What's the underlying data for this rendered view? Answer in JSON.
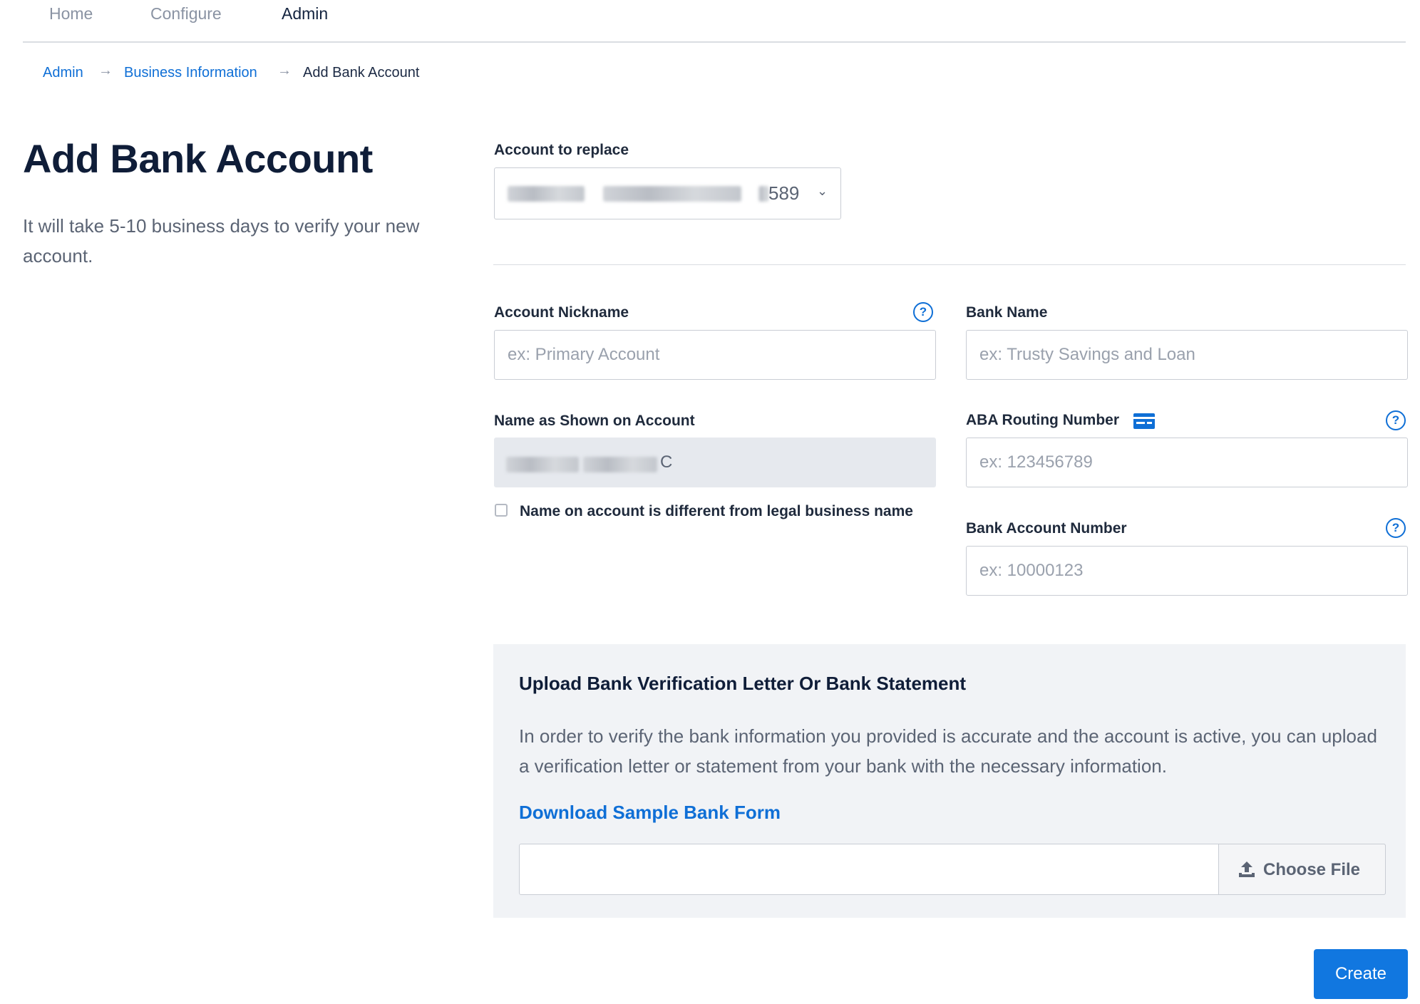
{
  "nav": {
    "items": [
      {
        "label": "Home",
        "active": false
      },
      {
        "label": "Configure",
        "active": false
      },
      {
        "label": "Admin",
        "active": true
      }
    ]
  },
  "breadcrumb": {
    "items": [
      "Admin",
      "Business Information",
      "Add Bank Account"
    ],
    "separator": "→"
  },
  "page": {
    "title": "Add Bank Account",
    "description": "It will take 5-10 business days to verify your new account."
  },
  "form": {
    "account_to_replace": {
      "label": "Account to replace",
      "value_suffix": "589"
    },
    "nickname": {
      "label": "Account Nickname",
      "placeholder": "ex: Primary Account"
    },
    "bank_name": {
      "label": "Bank Name",
      "placeholder": "ex: Trusty Savings and Loan"
    },
    "name_on_account": {
      "label": "Name as Shown on Account",
      "value_suffix": "C"
    },
    "name_different": {
      "label": "Name on account is different from legal business name",
      "checked": false
    },
    "routing": {
      "label": "ABA Routing Number",
      "placeholder": "ex: 123456789"
    },
    "account_number": {
      "label": "Bank Account Number",
      "placeholder": "ex: 10000123"
    },
    "help_glyph": "?"
  },
  "upload": {
    "title": "Upload Bank Verification Letter Or Bank Statement",
    "description": "In order to verify the bank information you provided is accurate and the account is active, you can upload a verification letter or statement from your bank with the necessary information.",
    "download_link": "Download Sample Bank Form",
    "choose_file": "Choose File"
  },
  "actions": {
    "create": "Create"
  },
  "colors": {
    "accent": "#1177e0",
    "link": "#0f6fd6",
    "panel": "#f1f3f6"
  }
}
